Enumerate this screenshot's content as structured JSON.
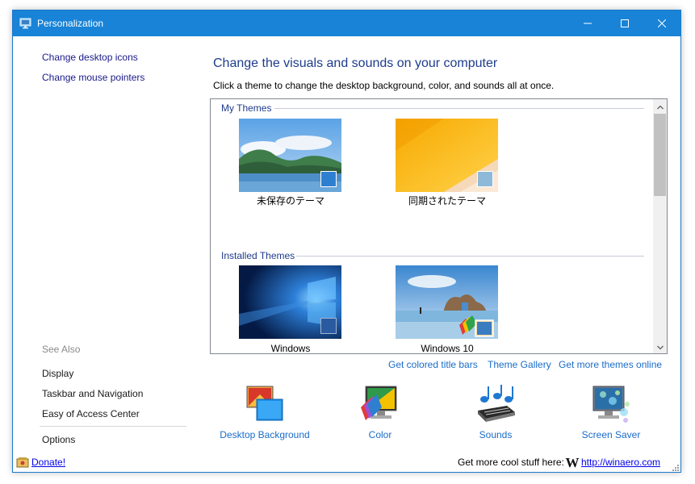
{
  "window": {
    "title": "Personalization"
  },
  "titlebar_buttons": {
    "minimize_icon": "minimize-icon",
    "maximize_icon": "maximize-icon",
    "close_icon": "close-icon"
  },
  "sidebar": {
    "links": [
      {
        "label": "Change desktop icons"
      },
      {
        "label": "Change mouse pointers"
      }
    ],
    "see_also_label": "See Also",
    "see_also": [
      {
        "label": "Display"
      },
      {
        "label": "Taskbar and Navigation"
      },
      {
        "label": "Easy of Access Center"
      }
    ],
    "options_label": "Options"
  },
  "main": {
    "heading": "Change the visuals and sounds on your computer",
    "subheading": "Click a theme to change the desktop background, color, and sounds all at once."
  },
  "themes": {
    "groups": [
      {
        "name": "My Themes",
        "items": [
          {
            "label": "未保存のテーマ",
            "accent": "#2f7fd0"
          },
          {
            "label": "同期されたテーマ",
            "accent": "#8fb9d8"
          }
        ]
      },
      {
        "name": "Installed Themes",
        "items": [
          {
            "label": "Windows",
            "accent": "#2a5aa0"
          },
          {
            "label": "Windows 10",
            "accent": "#3b8fd0"
          }
        ]
      }
    ]
  },
  "links_row": [
    {
      "label": "Get colored title bars"
    },
    {
      "label": "Theme Gallery"
    },
    {
      "label": "Get more themes online"
    }
  ],
  "bottom_items": [
    {
      "label": "Desktop Background",
      "icon": "desktop-background-icon"
    },
    {
      "label": "Color",
      "icon": "color-icon"
    },
    {
      "label": "Sounds",
      "icon": "sounds-icon"
    },
    {
      "label": "Screen Saver",
      "icon": "screen-saver-icon"
    }
  ],
  "status_bar": {
    "donate": "Donate!",
    "cool_text": "Get more cool stuff here:",
    "winaero_link": "http://winaero.com",
    "logo_letter": "W"
  },
  "colors": {
    "titlebar": "#1883d7",
    "heading": "#1e3c8c",
    "link": "#1a6cc8",
    "sidebar_link": "#1a1a8a"
  }
}
